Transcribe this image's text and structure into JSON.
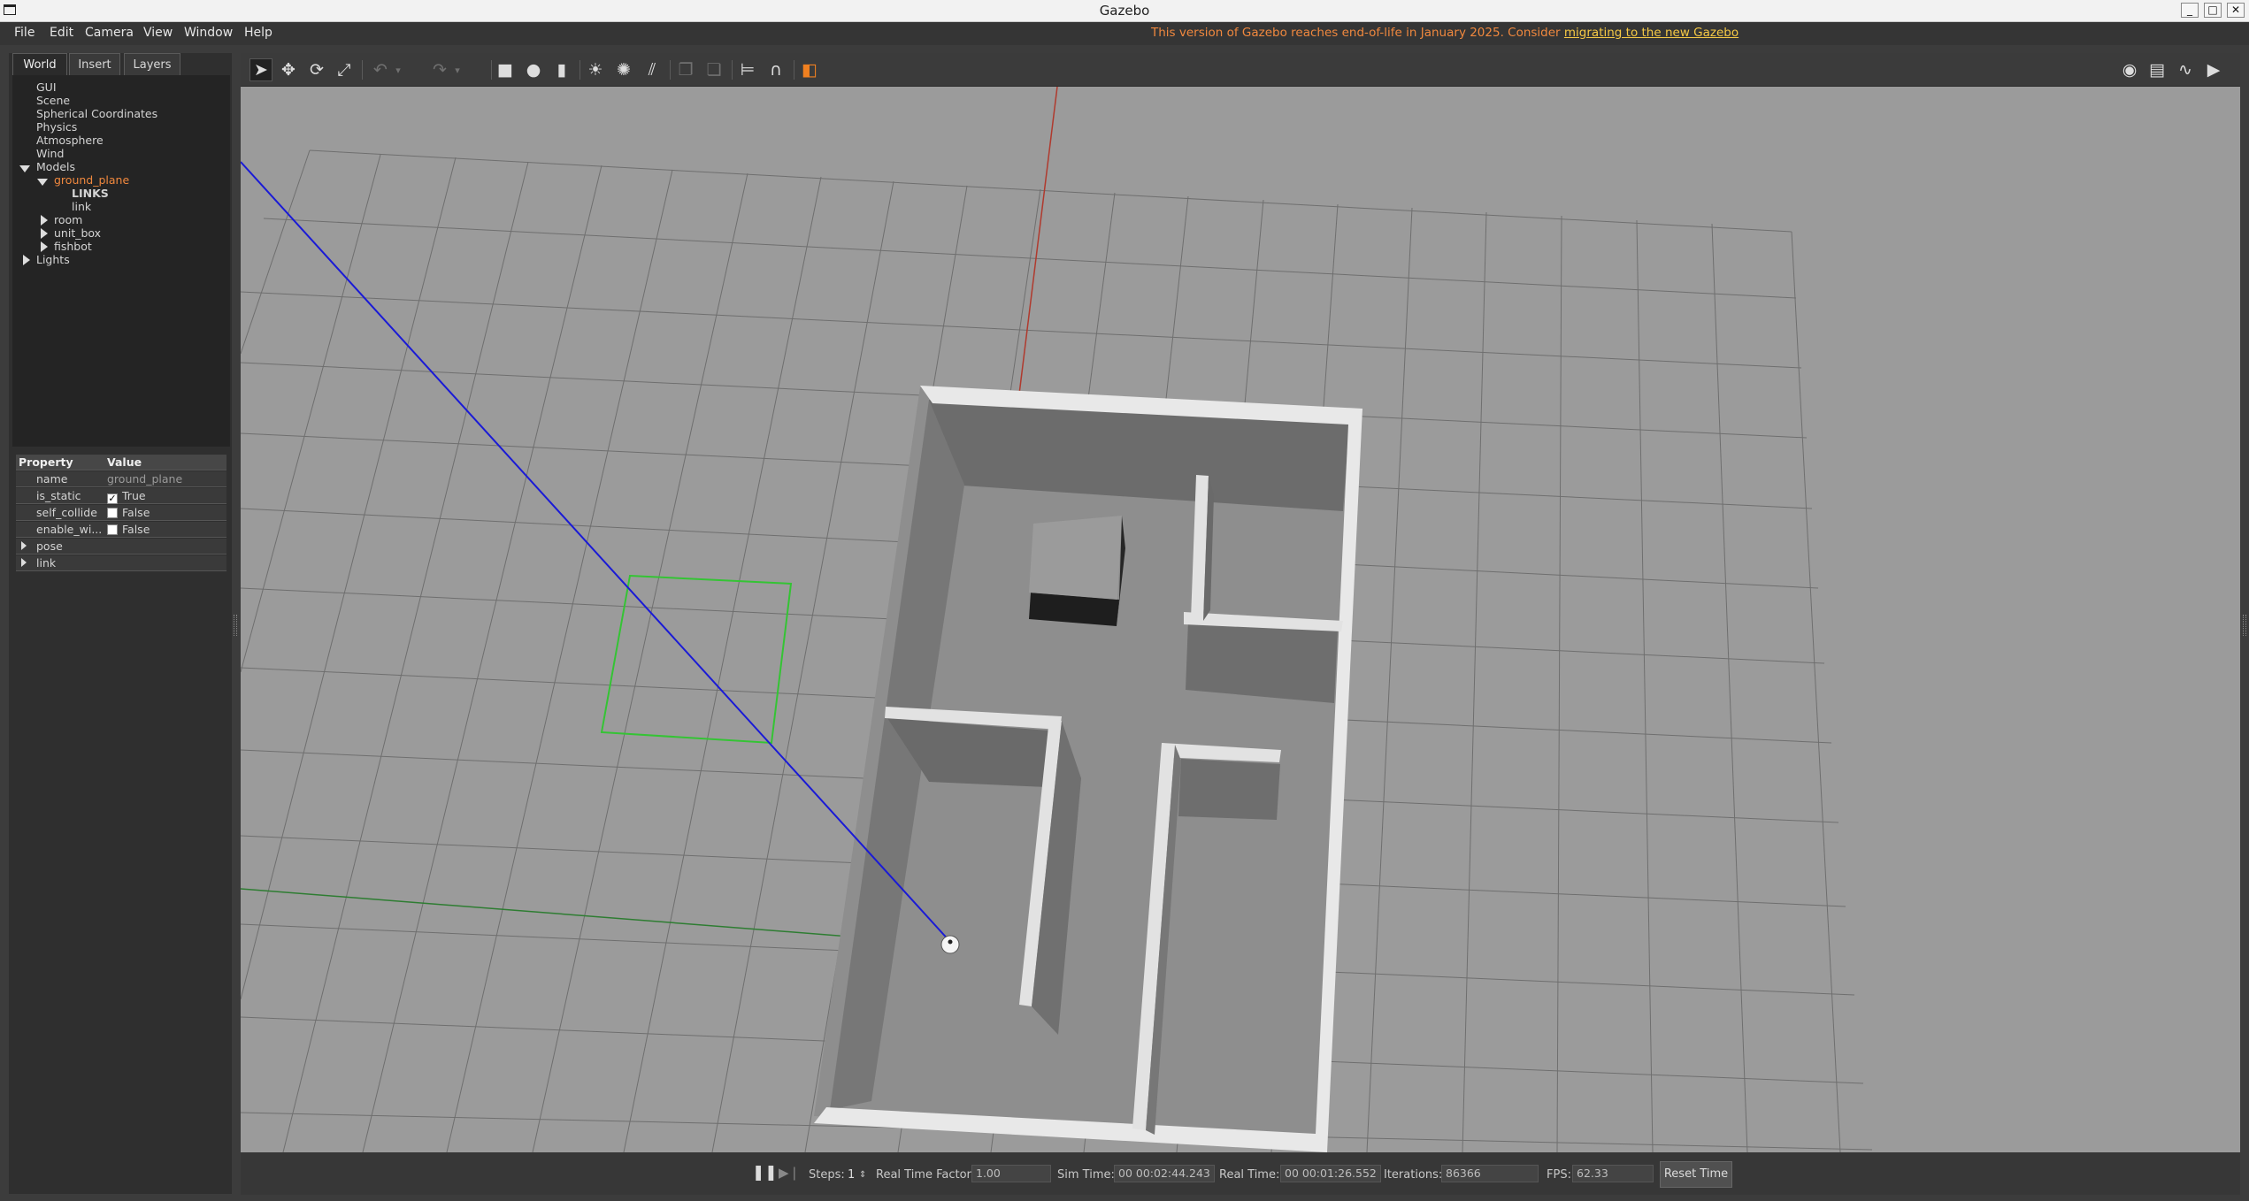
{
  "window": {
    "title": "Gazebo"
  },
  "menu": {
    "items": [
      "File",
      "Edit",
      "Camera",
      "View",
      "Window",
      "Help"
    ]
  },
  "notice": {
    "text": "This version of Gazebo reaches end-of-life in January 2025. Consider ",
    "link": "migrating to the new Gazebo"
  },
  "tabs": [
    "World",
    "Insert",
    "Layers"
  ],
  "tree": {
    "gui": "GUI",
    "scene": "Scene",
    "spherical": "Spherical Coordinates",
    "physics": "Physics",
    "atmosphere": "Atmosphere",
    "wind": "Wind",
    "models": "Models",
    "ground_plane": "ground_plane",
    "links": "LINKS",
    "link": "link",
    "room": "room",
    "unit_box": "unit_box",
    "fishbot": "fishbot",
    "lights": "Lights"
  },
  "properties": {
    "header_property": "Property",
    "header_value": "Value",
    "rows": [
      {
        "key": "name",
        "value": "ground_plane"
      },
      {
        "key": "is_static",
        "value": "True",
        "checked": true
      },
      {
        "key": "self_collide",
        "value": "False",
        "checked": false
      },
      {
        "key": "enable_wi...",
        "value": "False",
        "checked": false
      },
      {
        "key": "pose",
        "value": ""
      },
      {
        "key": "link",
        "value": ""
      }
    ]
  },
  "toolbar": {
    "icons": [
      "select-arrow-icon",
      "translate-icon",
      "rotate-icon",
      "scale-icon",
      "undo-icon",
      "redo-icon",
      "box-icon",
      "sphere-icon",
      "cylinder-icon",
      "point-light-icon",
      "spot-light-icon",
      "directional-light-icon",
      "copy-icon",
      "paste-icon",
      "align-icon",
      "snap-icon",
      "change-view-icon",
      "screenshot-icon",
      "log-icon",
      "plot-icon",
      "record-video-icon"
    ]
  },
  "colors": {
    "x_axis": "#c0392b",
    "y_axis": "#2ecc40",
    "z_axis": "#1a1ad6",
    "eol_text": "#f0883e",
    "eol_link": "#f6c945",
    "selected_tree_item": "#f0883e"
  },
  "bottom": {
    "steps_label": "Steps:",
    "steps_value": "1",
    "rtf_label": "Real Time Factor:",
    "rtf_value": "1.00",
    "sim_time_label": "Sim Time:",
    "sim_time_value": "00 00:02:44.243",
    "real_time_label": "Real Time:",
    "real_time_value": "00 00:01:26.552",
    "iterations_label": "Iterations:",
    "iterations_value": "86366",
    "fps_label": "FPS:",
    "fps_value": "62.33",
    "reset_label": "Reset Time"
  }
}
